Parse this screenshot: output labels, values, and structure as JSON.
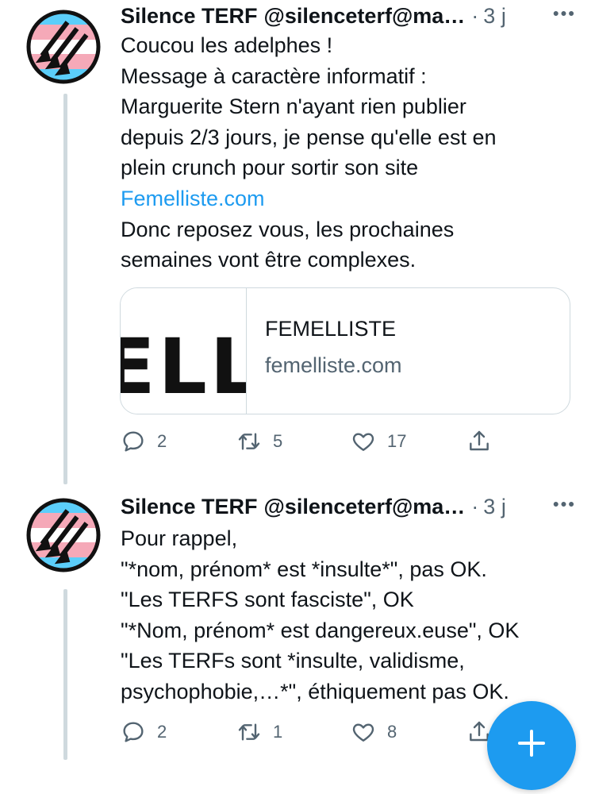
{
  "tweets": [
    {
      "author": "Silence TERF",
      "handle": "@silenceterf@ma…",
      "time": "3 j",
      "lines": [
        "Coucou les adelphes !",
        "Message à caractère informatif :",
        "Marguerite Stern n'ayant rien publier",
        "depuis 2/3 jours, je pense qu'elle est en",
        "plein crunch pour sortir son site"
      ],
      "link_text": "Femelliste.com",
      "lines_after": [
        "Donc reposez vous, les prochaines",
        "semaines vont être complexes."
      ],
      "card": {
        "thumb_text": "ELL",
        "site_name": "FEMELLISTE",
        "domain": "femelliste.com"
      },
      "replies": "2",
      "reposts": "5",
      "likes": "17"
    },
    {
      "author": "Silence TERF",
      "handle": "@silenceterf@ma…",
      "time": "3 j",
      "lines": [
        "Pour rappel,",
        "\"*nom, prénom* est *insulte*\", pas OK.",
        "\"Les TERFS sont fasciste\", OK",
        "\"*Nom, prénom* est dangereux.euse\", OK",
        "\"Les TERFs sont *insulte, validisme,",
        "psychophobie,…*\", éthiquement pas OK."
      ],
      "replies": "2",
      "reposts": "1",
      "likes": "8"
    }
  ],
  "icons": {
    "more": "more-horizontal-icon",
    "reply": "speech-bubble-icon",
    "repost": "repost-arrows-icon",
    "like": "heart-icon",
    "share": "share-upload-icon",
    "compose": "plus-icon"
  },
  "colors": {
    "accent": "#1d9bf0",
    "secondary_text": "#536471",
    "border": "#cfd9de",
    "avatar_light_blue": "#5bcefa",
    "avatar_pink": "#f5a9b8"
  }
}
